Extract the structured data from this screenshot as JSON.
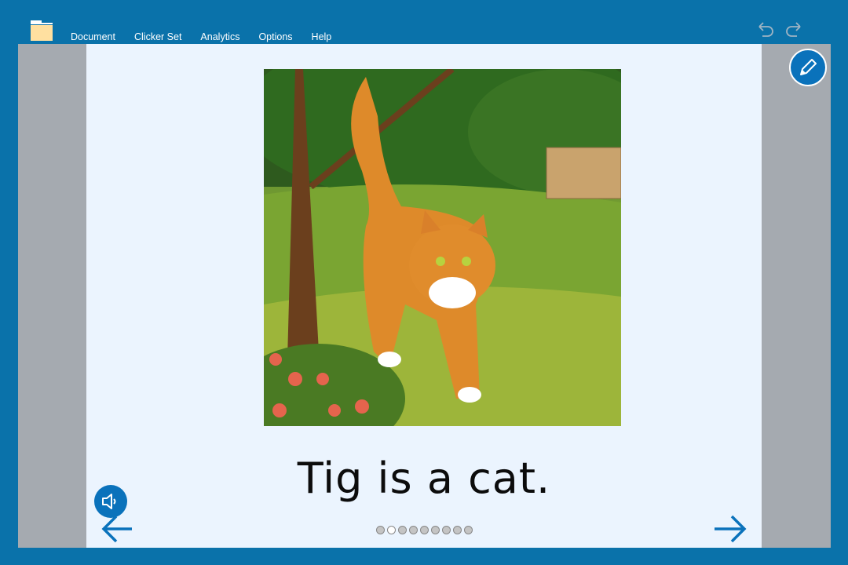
{
  "menu": {
    "items": [
      "Document",
      "Clicker Set",
      "Analytics",
      "Options",
      "Help"
    ]
  },
  "toolbar": {
    "folder_icon": "folder-icon",
    "undo_icon": "undo-icon",
    "redo_icon": "redo-icon",
    "pencil_icon": "pencil-icon"
  },
  "page": {
    "image_description": "Orange tabby cat walking through a grassy garden with a tree, bushes and wooden fence",
    "sentence": "Tig is a cat."
  },
  "navigation": {
    "speaker_icon": "speaker-icon",
    "prev_icon": "arrow-left-icon",
    "next_icon": "arrow-right-icon",
    "page_count": 9,
    "current_page": 2
  },
  "colors": {
    "frame": "#0a72aa",
    "accent": "#0a72bb",
    "page_bg": "#ebf4fe",
    "side_gray": "#a5aab0"
  }
}
